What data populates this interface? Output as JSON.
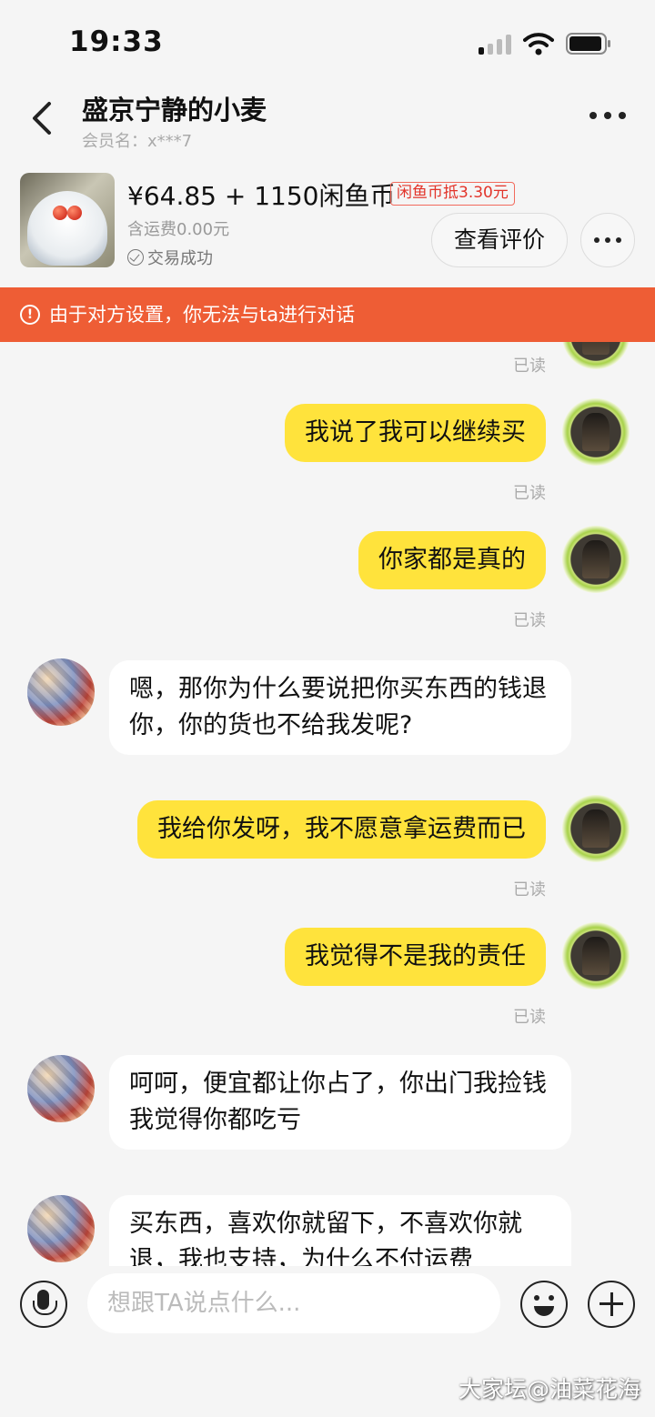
{
  "status_bar": {
    "time": "19:33"
  },
  "header": {
    "title": "盛京宁静的小麦",
    "subtitle": "会员名：x***7"
  },
  "product": {
    "price": "¥64.85 + 1150闲鱼币",
    "coin_tag": "闲鱼币抵3.30元",
    "shipping": "含运费0.00元",
    "status": "交易成功",
    "review_button": "查看评价"
  },
  "banner": {
    "text": "由于对方设置，你无法与ta进行对话"
  },
  "chat": {
    "read_label": "已读",
    "messages": [
      {
        "from": "me",
        "text": "我说了我可以继续买"
      },
      {
        "from": "me",
        "text": "你家都是真的"
      },
      {
        "from": "them",
        "text": "嗯，那你为什么要说把你买东西的钱退你，你的货也不给我发呢?"
      },
      {
        "from": "me",
        "text": "我给你发呀，我不愿意拿运费而已"
      },
      {
        "from": "me",
        "text": "我觉得不是我的责任"
      },
      {
        "from": "them",
        "text": "呵呵，便宜都让你占了，你出门我捡钱我觉得你都吃亏"
      },
      {
        "from": "them",
        "text": "买东西，喜欢你就留下，不喜欢你就退，我也支持，为什么不付运费"
      }
    ]
  },
  "input": {
    "placeholder": "想跟TA说点什么..."
  },
  "watermark": "大家坛@油菜花海",
  "colors": {
    "accent_yellow": "#ffe33c",
    "banner_orange": "#ee5d35",
    "tag_red": "#e2342a"
  },
  "icons": [
    "back-arrow-icon",
    "more-icon",
    "check-circle-icon",
    "warning-icon",
    "microphone-icon",
    "emoji-icon",
    "plus-icon"
  ]
}
